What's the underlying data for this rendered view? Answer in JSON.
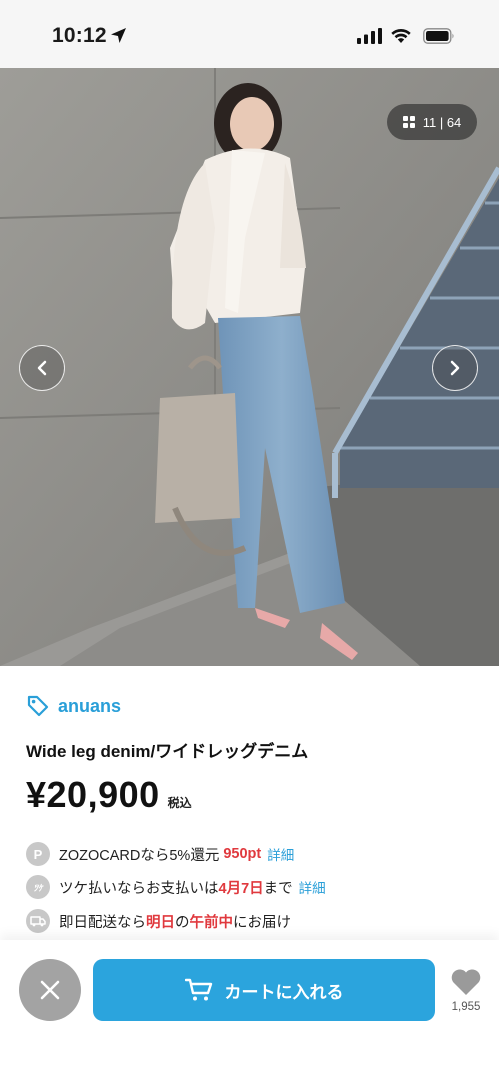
{
  "status_bar": {
    "time": "10:12"
  },
  "gallery": {
    "counter": "11 | 64"
  },
  "product": {
    "brand": "anuans",
    "name": "Wide leg denim/ワイドレッグデニム",
    "price": "¥20,900",
    "tax_label": "税込"
  },
  "info": {
    "card": {
      "icon_letter": "P",
      "prefix": "ZOZOCARDなら5%還元 ",
      "points": "950pt",
      "link": "詳細"
    },
    "tsuke": {
      "icon_letter": "ﾂｹ",
      "prefix": "ツケ払いならお支払いは",
      "date": "4月7日",
      "suffix": "まで",
      "link": "詳細"
    },
    "delivery": {
      "prefix": "即日配送なら",
      "highlight1": "明日",
      "middle": "の",
      "highlight2": "午前中",
      "suffix": "にお届け"
    }
  },
  "actions": {
    "cart_label": "カートに入れる",
    "like_count": "1,955"
  },
  "colors": {
    "accent": "#2ba4dd",
    "brand": "#2a9fd8",
    "highlight": "#e0393e"
  }
}
